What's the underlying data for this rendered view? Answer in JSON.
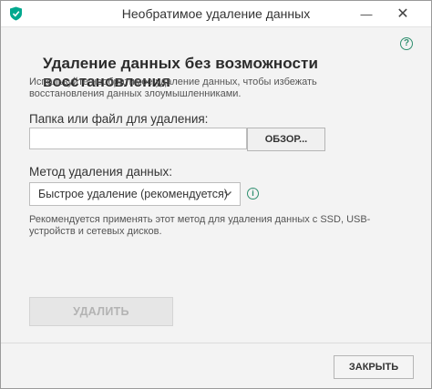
{
  "window": {
    "title": "Необратимое удаление данных",
    "minimize_glyph": "—",
    "close_glyph": "✕",
    "app_icon": "kaspersky-shield-icon"
  },
  "help": {
    "glyph": "?",
    "icon": "help-icon"
  },
  "main": {
    "heading": "Удаление данных без возможности восстановления",
    "description": "Используйте необратимое удаление данных, чтобы избежать восстановления данных злоумышленниками.",
    "path_label": "Папка или файл для удаления:",
    "path_value": "",
    "path_placeholder": "",
    "browse_label": "ОБЗОР...",
    "method_label": "Метод удаления данных:",
    "method_selected": "Быстрое удаление (рекомендуется)",
    "info_glyph": "i",
    "method_note": "Рекомендуется применять этот метод для удаления данных с SSD, USB-устройств и сетевых дисков.",
    "delete_label": "УДАЛИТЬ"
  },
  "footer": {
    "close_label": "ЗАКРЫТЬ"
  },
  "colors": {
    "accent": "#2f8f6f",
    "brand_shield": "#00a88e",
    "disabled_text": "#b3b3b3",
    "background": "#f3f3f3"
  }
}
